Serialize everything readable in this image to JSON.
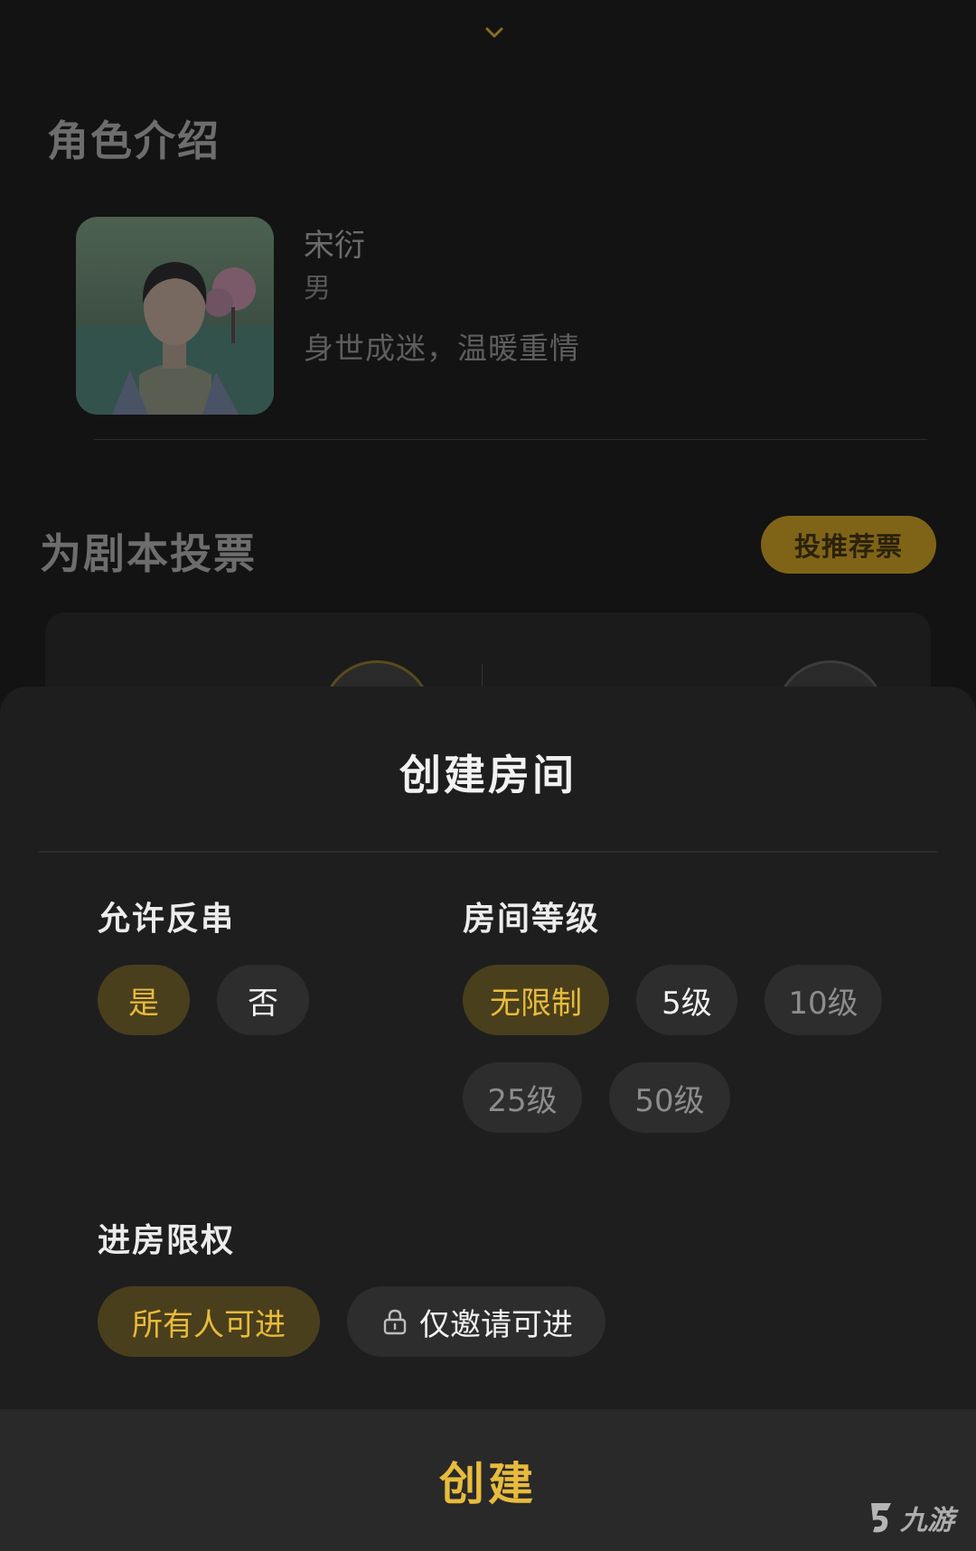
{
  "background": {
    "intro_title": "角色介绍",
    "character": {
      "name": "宋衍",
      "gender": "男",
      "description": "身世成迷，温暖重情"
    },
    "vote_title": "为剧本投票",
    "vote_button_label": "投推荐票"
  },
  "sheet": {
    "title": "创建房间",
    "backstab": {
      "label": "允许反串",
      "options": [
        "是",
        "否"
      ],
      "selected": "是"
    },
    "room_level": {
      "label": "房间等级",
      "options": [
        "无限制",
        "5级",
        "10级",
        "25级",
        "50级"
      ],
      "selected": "无限制"
    },
    "access": {
      "label": "进房限权",
      "options": [
        "所有人可进",
        "仅邀请可进"
      ],
      "selected": "所有人可进"
    },
    "create_label": "创建"
  },
  "watermark": {
    "text": "九游"
  },
  "colors": {
    "accent": "#e8bb3c",
    "selected_bg": "#4a3f1c",
    "sheet_bg": "#1e1e1e",
    "pill_bg": "#2d2d2d"
  },
  "icons": {
    "collapse": "chevron-down-icon",
    "invite": "lock-icon"
  }
}
